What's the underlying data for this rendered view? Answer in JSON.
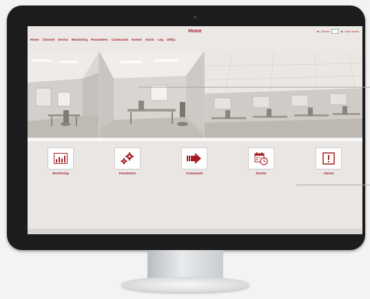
{
  "app": {
    "title": "Home",
    "user_info": {
      "device_label": "Device",
      "user_label": "User admin"
    }
  },
  "menu": [
    {
      "label": "Home"
    },
    {
      "label": "Channel"
    },
    {
      "label": "Device"
    },
    {
      "label": "Monitoring"
    },
    {
      "label": "Parameters"
    },
    {
      "label": "Commands"
    },
    {
      "label": "Events"
    },
    {
      "label": "Alarm"
    },
    {
      "label": "Log"
    },
    {
      "label": "Utility"
    }
  ],
  "tiles": [
    {
      "label": "Monitoring",
      "icon": "bar-chart-icon"
    },
    {
      "label": "Parameters",
      "icon": "gears-icon"
    },
    {
      "label": "Commands",
      "icon": "arrow-right-icon"
    },
    {
      "label": "Events",
      "icon": "calendar-clock-icon"
    },
    {
      "label": "Alarms",
      "icon": "exclamation-icon"
    }
  ],
  "colors": {
    "accent": "#a31c22",
    "screen_bg": "#e9e6e4",
    "bezel": "#1c1c1c"
  }
}
